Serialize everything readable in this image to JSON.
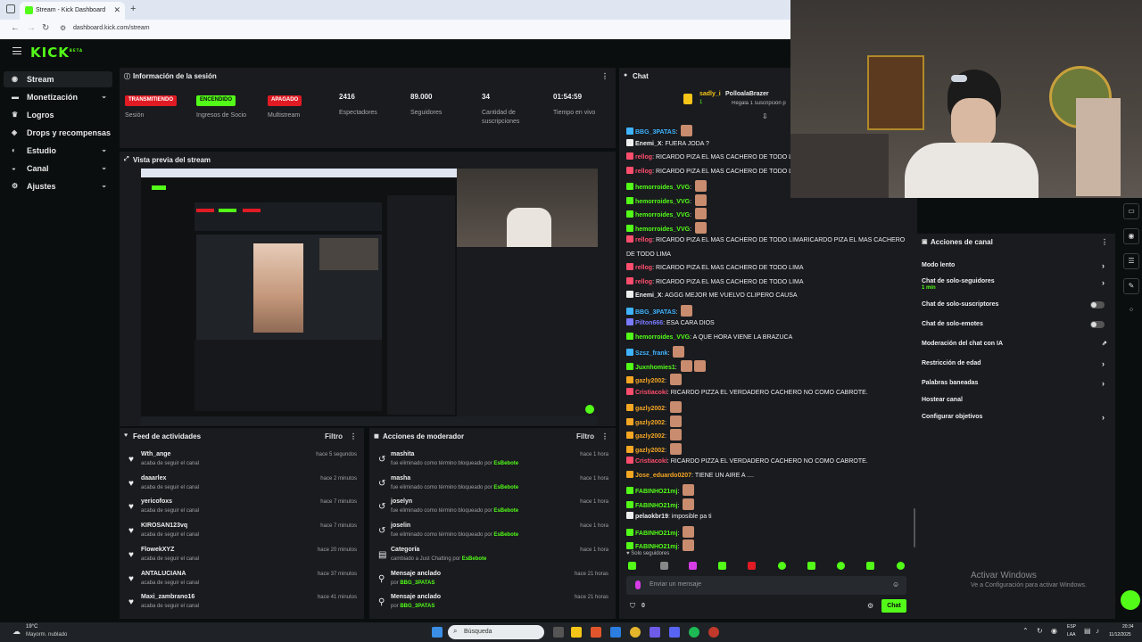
{
  "browser": {
    "tab_title": "Stream - Kick Dashboard",
    "url": "dashboard.kick.com/stream",
    "new_tab": "+"
  },
  "brand": {
    "logo": "KICK",
    "logo_sup": "BETA"
  },
  "sidebar": {
    "items": [
      {
        "label": "Stream",
        "icon": "broadcast-icon",
        "chevron": false
      },
      {
        "label": "Monetización",
        "icon": "money-icon",
        "chevron": true
      },
      {
        "label": "Logros",
        "icon": "trophy-icon",
        "chevron": false
      },
      {
        "label": "Drops y recompensas",
        "icon": "gift-icon",
        "chevron": false
      },
      {
        "label": "Estudio",
        "icon": "studio-icon",
        "chevron": true
      },
      {
        "label": "Canal",
        "icon": "channel-icon",
        "chevron": true
      },
      {
        "label": "Ajustes",
        "icon": "gear-icon",
        "chevron": true
      }
    ]
  },
  "session": {
    "title": "Información de la sesión",
    "stats": [
      {
        "badge": "TRANSMITIENDO",
        "badge_color": "#e01b24",
        "label": "Sesión"
      },
      {
        "badge": "ENCENDIDO",
        "badge_color": "#53fc18",
        "label": "Ingresos de Socio"
      },
      {
        "badge": "APAGADO",
        "badge_color": "#e01b24",
        "label": "Multistream"
      },
      {
        "value": "2416",
        "label": "Espectadores"
      },
      {
        "value": "89.000",
        "label": "Seguidores"
      },
      {
        "value": "34",
        "label": "Cantidad de suscripciones"
      },
      {
        "value": "01:54:59",
        "label": "Tiempo en vivo"
      }
    ]
  },
  "preview": {
    "title": "Vista previa del stream"
  },
  "feed": {
    "title": "Feed de actividades",
    "filter": "Filtro",
    "items": [
      {
        "name": "Wth_ange",
        "sub": "acaba de seguir el canal",
        "time": "hace 5 segundos"
      },
      {
        "name": "daaarlex",
        "sub": "acaba de seguir el canal",
        "time": "hace 2 minutos"
      },
      {
        "name": "yericofoxs",
        "sub": "acaba de seguir el canal",
        "time": "hace 7 minutos"
      },
      {
        "name": "KIROSAN123vq",
        "sub": "acaba de seguir el canal",
        "time": "hace 7 minutos"
      },
      {
        "name": "FlowekXYZ",
        "sub": "acaba de seguir el canal",
        "time": "hace 20 minutos"
      },
      {
        "name": "ANTALUCIANA",
        "sub": "acaba de seguir el canal",
        "time": "hace 37 minutos"
      },
      {
        "name": "Maxi_zambrano16",
        "sub": "acaba de seguir el canal",
        "time": "hace 41 minutos"
      }
    ]
  },
  "mod": {
    "title": "Acciones de moderador",
    "filter": "Filtro",
    "items": [
      {
        "name": "mashita",
        "sub": "fue eliminado como término bloqueado por",
        "by": "EsBebote",
        "time": "hace 1 hora",
        "icon": "undo-icon"
      },
      {
        "name": "masha",
        "sub": "fue eliminado como término bloqueado por",
        "by": "EsBebote",
        "time": "hace 1 hora",
        "icon": "undo-icon"
      },
      {
        "name": "joselyn",
        "sub": "fue eliminado como término bloqueado por",
        "by": "EsBebote",
        "time": "hace 1 hora",
        "icon": "undo-icon"
      },
      {
        "name": "joselin",
        "sub": "fue eliminado como término bloqueado por",
        "by": "EsBebote",
        "time": "hace 1 hora",
        "icon": "undo-icon"
      },
      {
        "name": "Categoría",
        "sub": "cambiado a Just Chatting por",
        "by": "EsBebote",
        "time": "hace 1 hora",
        "icon": "category-icon"
      },
      {
        "name": "Mensaje anclado",
        "sub": "por",
        "by": "BBG_3PATAS",
        "time": "hace 21 horas",
        "icon": "pin-icon"
      },
      {
        "name": "Mensaje anclado",
        "sub": "por",
        "by": "BBG_3PATAS",
        "time": "hace 21 horas",
        "icon": "pin-icon"
      }
    ]
  },
  "chat": {
    "title": "Chat",
    "pinned": {
      "user": "sadly_i",
      "count": "1",
      "target": "PolloalaBrazer",
      "note": "Regala 1 suscripción p"
    },
    "messages": [
      {
        "user": "BBG_3PATAS",
        "color": "#3fb3ff",
        "text": "",
        "emotes": 1
      },
      {
        "user": "Enemi_X",
        "color": "#eeeeee",
        "text": "FUERA JODA ?",
        "emotes": 0
      },
      {
        "user": "rellog",
        "color": "#ff4d6d",
        "text": "RICARDO PIZA EL MAS CACHERO DE TODO L",
        "emotes": 0
      },
      {
        "user": "rellog",
        "color": "#ff4d6d",
        "text": "RICARDO PIZA EL MAS CACHERO DE TODO L",
        "emotes": 0
      },
      {
        "user": "hemorroides_VVG",
        "color": "#53fc18",
        "text": "",
        "emotes": 1
      },
      {
        "user": "hemorroides_VVG",
        "color": "#53fc18",
        "text": "",
        "emotes": 1
      },
      {
        "user": "hemorroides_VVG",
        "color": "#53fc18",
        "text": "",
        "emotes": 1
      },
      {
        "user": "hemorroides_VVG",
        "color": "#53fc18",
        "text": "",
        "emotes": 1
      },
      {
        "user": "rellog",
        "color": "#ff4d6d",
        "text": "RICARDO PIZA EL MAS CACHERO DE TODO LIMARICARDO PIZA EL MAS CACHERO",
        "emotes": 0
      },
      {
        "user": "",
        "color": "#eeeeee",
        "text": "DE TODO LIMA",
        "emotes": 0
      },
      {
        "user": "rellog",
        "color": "#ff4d6d",
        "text": "RICARDO PIZA EL MAS CACHERO DE TODO LIMA",
        "emotes": 0
      },
      {
        "user": "rellog",
        "color": "#ff4d6d",
        "text": "RICARDO PIZA EL MAS CACHERO DE TODO LIMA",
        "emotes": 0
      },
      {
        "user": "Enemi_X",
        "color": "#eeeeee",
        "text": "AGGG MEJOR ME VUELVO CLIPERO CAUSA",
        "emotes": 0
      },
      {
        "user": "BBG_3PATAS",
        "color": "#3fb3ff",
        "text": "",
        "emotes": 1
      },
      {
        "user": "Pilton666",
        "color": "#7a7aff",
        "text": "ESA CARA DIOS",
        "emotes": 0
      },
      {
        "user": "hemorroides_VVG",
        "color": "#53fc18",
        "text": "A QUE HORA VIENE LA BRAZUCA",
        "emotes": 0
      },
      {
        "user": "Szsz_frank",
        "color": "#3fb3ff",
        "text": "",
        "emotes": 1
      },
      {
        "user": "Juxnhomies1",
        "color": "#53fc18",
        "text": "",
        "emotes": 2
      },
      {
        "user": "gazly2002",
        "color": "#f5a623",
        "text": "",
        "emotes": 1
      },
      {
        "user": "Cristiacoki",
        "color": "#ff4d6d",
        "text": "RICARDO PIZZA EL VERDADERO CACHERO NO COMO CABROTE.",
        "emotes": 0
      },
      {
        "user": "gazly2002",
        "color": "#f5a623",
        "text": "",
        "emotes": 1
      },
      {
        "user": "gazly2002",
        "color": "#f5a623",
        "text": "",
        "emotes": 1
      },
      {
        "user": "gazly2002",
        "color": "#f5a623",
        "text": "",
        "emotes": 1
      },
      {
        "user": "gazly2002",
        "color": "#f5a623",
        "text": "",
        "emotes": 1
      },
      {
        "user": "Cristiacoki",
        "color": "#ff4d6d",
        "text": "RICARDO PIZZA EL VERDADERO CACHERO NO COMO CABROTE.",
        "emotes": 0
      },
      {
        "user": "Jose_eduardo0207",
        "color": "#f5a623",
        "text": "TIENE UN AIRE A ....",
        "emotes": 0
      },
      {
        "user": "FABINHO21mj",
        "color": "#53fc18",
        "text": "",
        "emotes": 1
      },
      {
        "user": "FABINHO21mj",
        "color": "#53fc18",
        "text": "",
        "emotes": 1
      },
      {
        "user": "pelaokbr19",
        "color": "#eeeeee",
        "text": "imposible pa ti",
        "emotes": 0
      },
      {
        "user": "FABINHO21mj",
        "color": "#53fc18",
        "text": "",
        "emotes": 1
      },
      {
        "user": "FABINHO21mj",
        "color": "#53fc18",
        "text": "",
        "emotes": 1
      }
    ],
    "mode": "Solo seguidores",
    "placeholder": "Enviar un mensaje",
    "viewer_count": "0",
    "send": "Chat"
  },
  "channel_actions": {
    "title": "Acciones de canal",
    "items": [
      {
        "label": "Modo lento",
        "control": "chevron"
      },
      {
        "label": "Chat de solo-seguidores",
        "sub": "1 min",
        "control": "chevron"
      },
      {
        "label": "Chat de solo-suscriptores",
        "control": "toggle"
      },
      {
        "label": "Chat de solo-emotes",
        "control": "toggle"
      },
      {
        "label": "Moderación del chat con IA",
        "control": "external"
      },
      {
        "label": "Restricción de edad",
        "control": "chevron"
      },
      {
        "label": "Palabras baneadas",
        "control": "chevron"
      },
      {
        "label": "Hostear canal",
        "control": "none"
      },
      {
        "label": "Configurar objetivos",
        "control": "chevron"
      }
    ]
  },
  "watermark": {
    "line1": "Activar Windows",
    "line2": "Ve a Configuración para activar Windows."
  },
  "taskbar": {
    "weather_temp": "19°C",
    "weather_desc": "Mayorm. nublado",
    "search": "Búsqueda",
    "lang": "ESP",
    "lang2": "LAA",
    "time": "20:34",
    "date": "11/12/2025"
  }
}
